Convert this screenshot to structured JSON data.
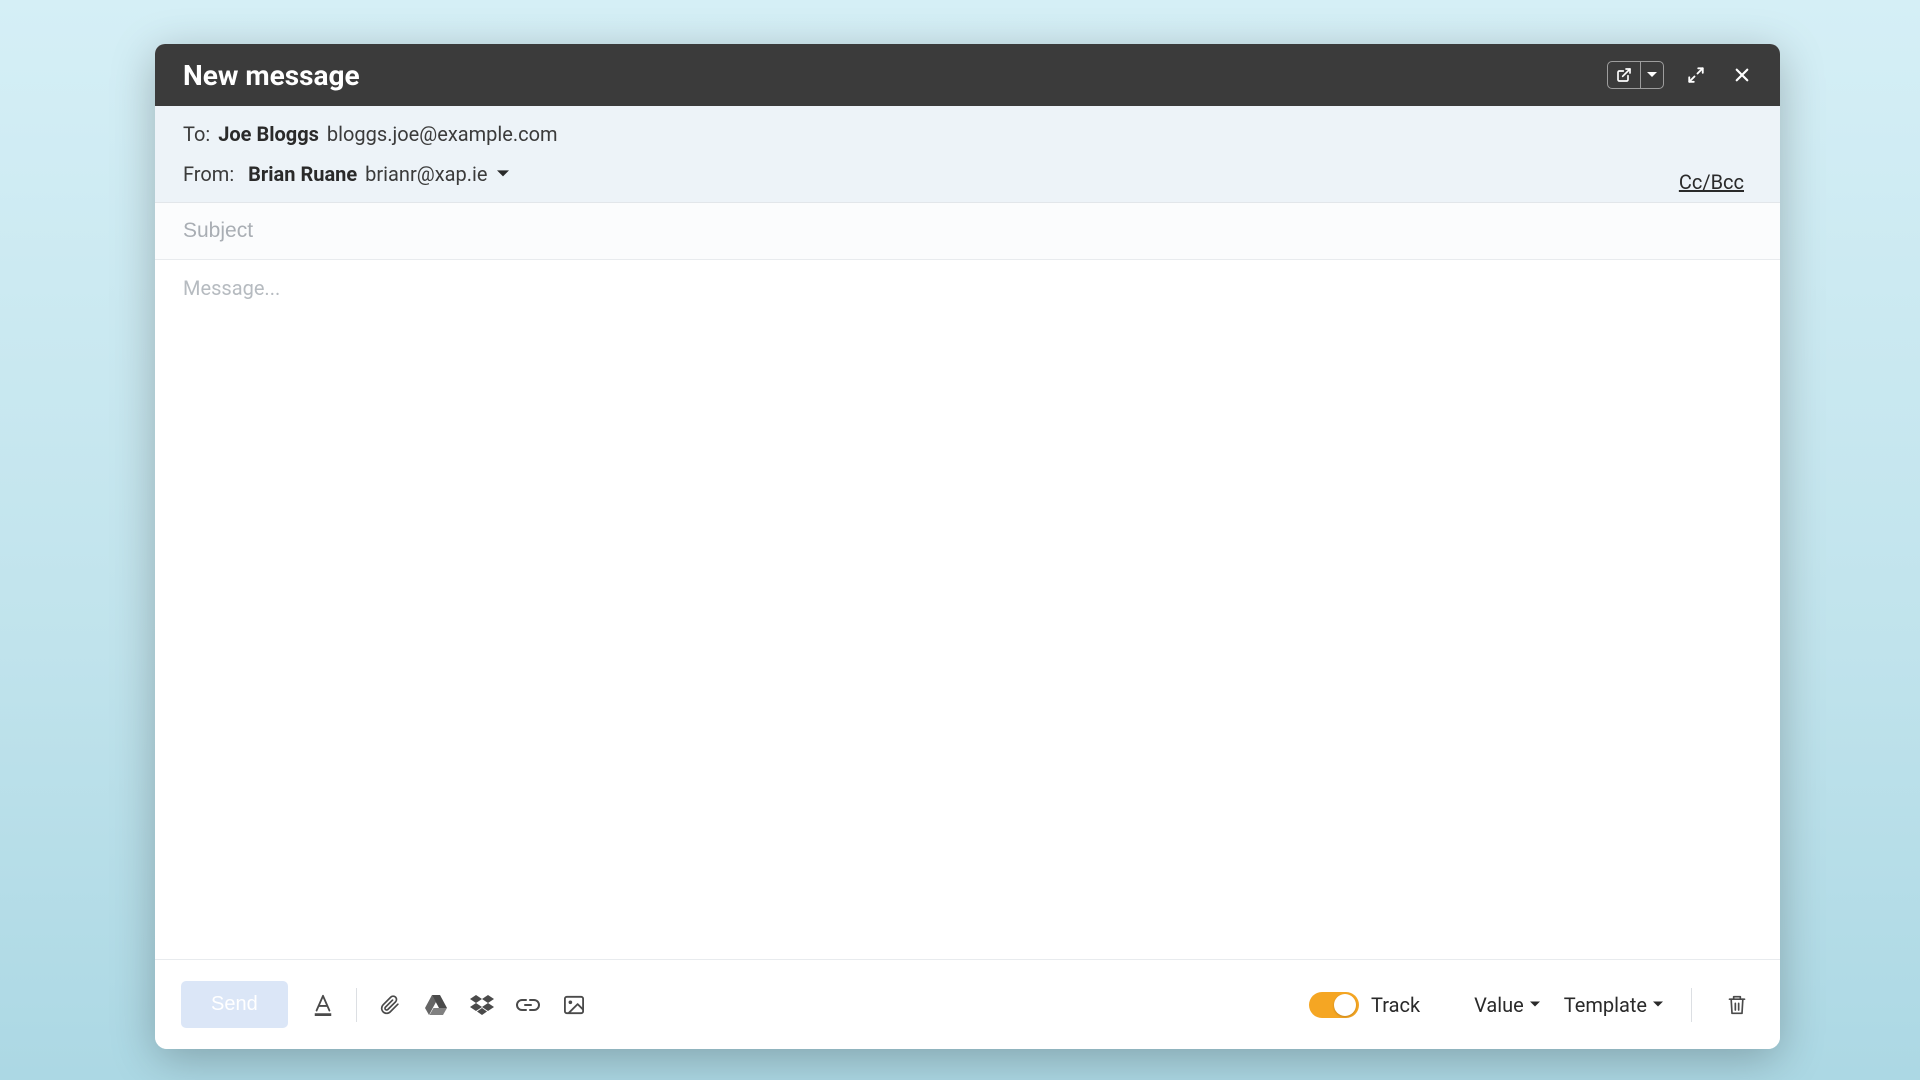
{
  "titlebar": {
    "title": "New message"
  },
  "addresses": {
    "to_label": "To:",
    "to_name": "Joe Bloggs",
    "to_email": "bloggs.joe@example.com",
    "from_label": "From:",
    "from_name": "Brian Ruane",
    "from_email": "brianr@xap.ie",
    "ccbcc": "Cc/Bcc"
  },
  "subject": {
    "placeholder": "Subject",
    "value": ""
  },
  "body": {
    "placeholder": "Message...",
    "value": ""
  },
  "toolbar": {
    "send_label": "Send",
    "track_label": "Track",
    "value_label": "Value",
    "template_label": "Template"
  }
}
